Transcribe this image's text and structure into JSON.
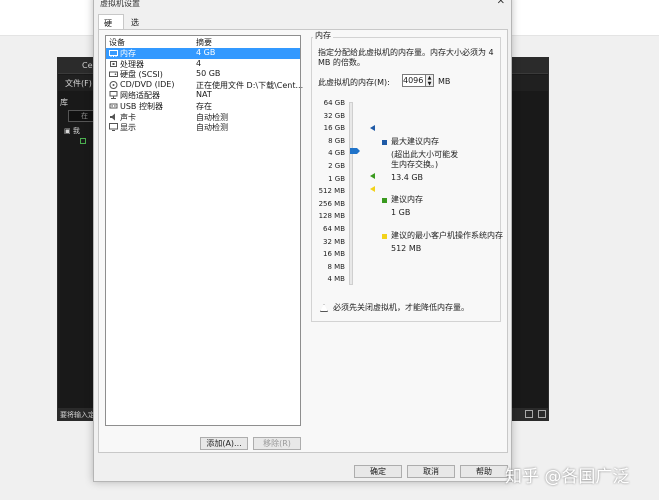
{
  "background_window": {
    "title": "Cen",
    "menu": "文件(F)",
    "library": "库",
    "search": "在",
    "tree": "我",
    "status": "要将输入定"
  },
  "dialog": {
    "title": "虚拟机设置",
    "tabs": [
      "硬件",
      "选项"
    ]
  },
  "devices": {
    "headers": {
      "device": "设备",
      "summary": "摘要"
    },
    "rows": [
      {
        "icon": "memory-icon",
        "name": "内存",
        "summary": "4 GB",
        "selected": true
      },
      {
        "icon": "cpu-icon",
        "name": "处理器",
        "summary": "4"
      },
      {
        "icon": "disk-icon",
        "name": "硬盘 (SCSI)",
        "summary": "50 GB"
      },
      {
        "icon": "cd-icon",
        "name": "CD/DVD (IDE)",
        "summary": "正在使用文件 D:\\下载\\Cent..."
      },
      {
        "icon": "network-icon",
        "name": "网络适配器",
        "summary": "NAT"
      },
      {
        "icon": "usb-icon",
        "name": "USB 控制器",
        "summary": "存在"
      },
      {
        "icon": "sound-icon",
        "name": "声卡",
        "summary": "自动检测"
      },
      {
        "icon": "display-icon",
        "name": "显示",
        "summary": "自动检测"
      }
    ],
    "add_button": "添加(A)...",
    "remove_button": "移除(R)"
  },
  "memory": {
    "group_label": "内存",
    "description": "指定分配给此虚拟机的内存量。内存大小必须为 4 MB 的倍数。",
    "field_label": "此虚拟机的内存(M):",
    "value": "4096",
    "unit": "MB",
    "scale": [
      "64 GB",
      "32 GB",
      "16 GB",
      "8 GB",
      "4 GB",
      "2 GB",
      "1 GB",
      "512 MB",
      "256 MB",
      "128 MB",
      "64 MB",
      "32 MB",
      "16 MB",
      "8 MB",
      "4 MB"
    ],
    "legend": {
      "max_label": "最大建议内存",
      "max_note": "(超出此大小可能发生内存交换。)",
      "max_value": "13.4 GB",
      "rec_label": "建议内存",
      "rec_value": "1 GB",
      "min_label": "建议的最小客户机操作系统内存",
      "min_value": "512 MB"
    },
    "warning": "必须先关闭虚拟机，才能降低内存量。",
    "colors": {
      "max": "#1f5aa6",
      "rec": "#3a9a1f",
      "min": "#f2d21a"
    }
  },
  "footer": {
    "ok": "确定",
    "cancel": "取消",
    "help": "帮助"
  },
  "watermark": "知乎 @各国广泛"
}
